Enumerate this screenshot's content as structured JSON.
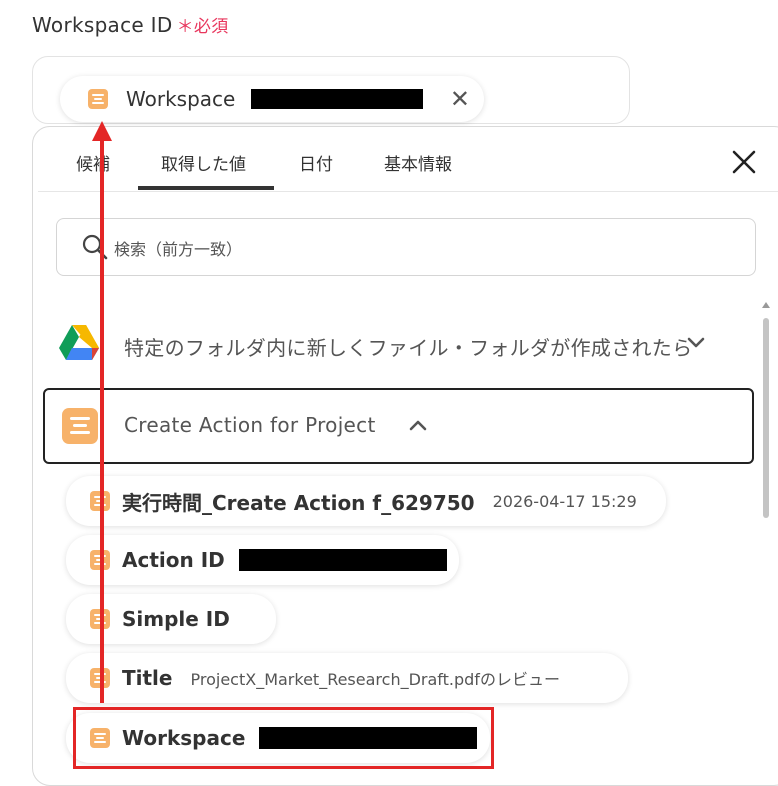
{
  "field": {
    "label": "Workspace ID",
    "required_mark": "＊",
    "required_text": "必須"
  },
  "selected_chip": {
    "name": "Workspace"
  },
  "tabs": [
    {
      "label": "候補"
    },
    {
      "label": "取得した値"
    },
    {
      "label": "日付"
    },
    {
      "label": "基本情報"
    }
  ],
  "active_tab_index": 1,
  "search": {
    "placeholder": "検索（前方一致）"
  },
  "trigger_group": {
    "title": "特定のフォルダ内に新しくファイル・フォルダが作成されたら",
    "expanded": false,
    "icon": "google-drive-icon"
  },
  "action_group": {
    "title": "Create Action for Project",
    "expanded": true,
    "icon": "app-icon"
  },
  "items": [
    {
      "name": "実行時間_Create Action f_629750",
      "value": "2026-04-17 15:29"
    },
    {
      "name": "Action ID",
      "value_redacted": true
    },
    {
      "name": "Simple ID",
      "value": ""
    },
    {
      "name": "Title",
      "value": "ProjectX_Market_Research_Draft.pdfのレビュー"
    },
    {
      "name": "Workspace",
      "value_redacted": true,
      "highlighted": true
    }
  ],
  "colors": {
    "accent_red": "#e32626",
    "required_pink": "#e8365d",
    "app_icon": "#f7b26a"
  }
}
